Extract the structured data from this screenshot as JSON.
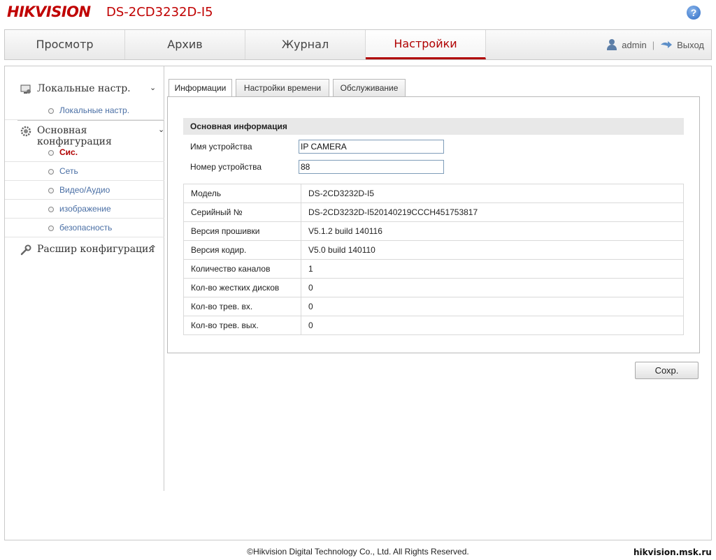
{
  "header": {
    "brand": "HIKVISION",
    "model": "DS-2CD3232D-I5",
    "help_symbol": "?"
  },
  "nav": {
    "tabs": [
      {
        "label": "Просмотр"
      },
      {
        "label": "Архив"
      },
      {
        "label": "Журнал"
      },
      {
        "label": "Настройки",
        "active": true
      }
    ],
    "user": "admin",
    "separator": "|",
    "logout": "Выход"
  },
  "sidebar": {
    "groups": [
      {
        "label": "Локальные настр.",
        "chevron": "⌄",
        "items": [
          {
            "label": "Локальные настр."
          }
        ]
      },
      {
        "label": "Основная конфигурация",
        "chevron": "⌄",
        "items": [
          {
            "label": "Сис.",
            "active": true
          },
          {
            "label": "Сеть"
          },
          {
            "label": "Видео/Аудио"
          },
          {
            "label": "изображение"
          },
          {
            "label": "безопасность"
          }
        ]
      },
      {
        "label": "Расшир конфигурация",
        "chevron": "^"
      }
    ]
  },
  "tabs": [
    {
      "label": "Информации",
      "active": true
    },
    {
      "label": "Настройки времени"
    },
    {
      "label": "Обслуживание"
    }
  ],
  "panel": {
    "section_title": "Основная информация",
    "fields": [
      {
        "label": "Имя устройства",
        "value": "IP CAMERA"
      },
      {
        "label": "Номер устройства",
        "value": "88"
      }
    ],
    "info": [
      {
        "key": "Модель",
        "value": "DS-2CD3232D-I5"
      },
      {
        "key": "Серийный №",
        "value": "DS-2CD3232D-I520140219CCCH451753817"
      },
      {
        "key": "Версия прошивки",
        "value": "V5.1.2 build 140116"
      },
      {
        "key": "Версия кодир.",
        "value": "V5.0 build 140110"
      },
      {
        "key": "Количество каналов",
        "value": "1"
      },
      {
        "key": "Кол-во жестких дисков",
        "value": "0"
      },
      {
        "key": "Кол-во трев. вх.",
        "value": "0"
      },
      {
        "key": "Кол-во трев. вых.",
        "value": "0"
      }
    ]
  },
  "save_label": "Сохр.",
  "footer": "©Hikvision Digital Technology Co., Ltd. All Rights Reserved.",
  "watermark": "hikvision.msk.ru",
  "colors": {
    "brand": "#c00000",
    "active_tab": "#b00000",
    "link": "#4a6fa5"
  }
}
